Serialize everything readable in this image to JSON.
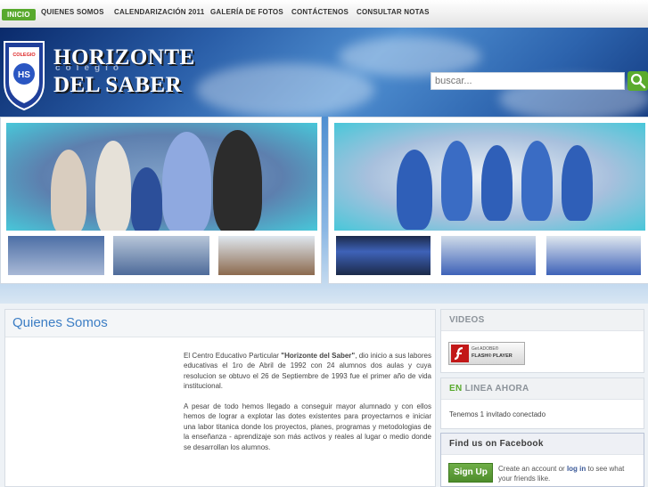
{
  "nav": {
    "items": [
      "INICIO",
      "QUIENES SOMOS",
      "CALENDARIZACIÓN 2011",
      "GALERÍA DE FOTOS",
      "CONTÁCTENOS",
      "CONSULTAR NOTAS"
    ]
  },
  "header": {
    "brand_small": "colegio",
    "brand_line1": "HORIZONTE",
    "brand_line2": "DEL SABER",
    "crest_text_top": "COLEGIO",
    "crest_text_bottom": "HORIZONTE DEL SABER",
    "crest_letters": "HS"
  },
  "search": {
    "placeholder": "buscar..."
  },
  "about": {
    "title": "Quienes Somos",
    "para1_prefix": "El Centro Educativo Particular ",
    "para1_bold": "\"Horizonte del Saber\"",
    "para1_rest": ", dio inicio a sus labores educativas el 1ro de Abril de 1992 con 24 alumnos dos aulas y cuya resolucion se obtuvo el 26 de Septiembre de 1993 fue el primer año de vida institucional.",
    "para2": "A pesar de todo hemos llegado a conseguir mayor alumnado y con ellos hemos de lograr a explotar las dotes existentes para proyectarnos e iniciar una labor titanica donde los proyectos, planes, programas y metodologias de la enseñanza - aprendizaje son más activos y reales al lugar o medio donde se desarrollan los alumnos."
  },
  "sidebar": {
    "videos_title": "VIDEOS",
    "flash_get": "Get ADOBE®",
    "flash_name": "FLASH® PLAYER",
    "online_title_prefix": "EN",
    "online_title_rest": " LINEA AHORA",
    "online_text": "Tenemos 1 invitado conectado",
    "facebook_title": "Find us on Facebook",
    "signup_label": "Sign Up",
    "fb_text_1": "Create an account or ",
    "fb_login": "log in",
    "fb_text_2": " to see what your friends like."
  },
  "colors": {
    "accent_green": "#58a92d",
    "title_blue": "#3b7dc4",
    "banner_blue": "#2a5ea8",
    "facebook_blue": "#3b5998"
  }
}
